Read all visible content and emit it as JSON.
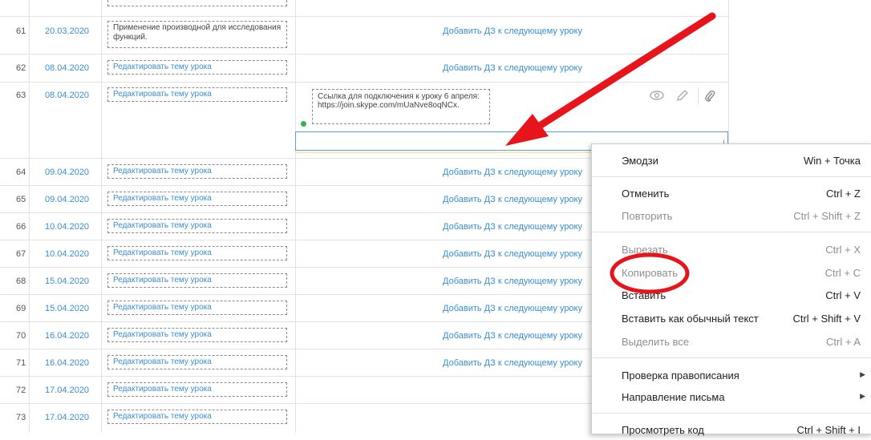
{
  "rows": [
    {
      "num": "61",
      "date": "20.03.2020",
      "topic": "Применение производной для исследования функций.",
      "topic_plain": true,
      "action": "Добавить ДЗ к следующему уроку"
    },
    {
      "num": "62",
      "date": "08.04.2020",
      "topic": "Редактировать тему урока",
      "topic_plain": false,
      "action": "Добавить ДЗ к следующему уроку"
    },
    {
      "num": "63",
      "date": "08.04.2020",
      "topic": "Редактировать тему урока",
      "topic_plain": false,
      "action": ""
    },
    {
      "num": "64",
      "date": "09.04.2020",
      "topic": "Редактировать тему урока",
      "topic_plain": false,
      "action": "Добавить ДЗ к следующему уроку"
    },
    {
      "num": "65",
      "date": "09.04.2020",
      "topic": "Редактировать тему урока",
      "topic_plain": false,
      "action": "Добавить ДЗ к следующему уроку"
    },
    {
      "num": "66",
      "date": "10.04.2020",
      "topic": "Редактировать тему урока",
      "topic_plain": false,
      "action": "Добавить ДЗ к следующему уроку"
    },
    {
      "num": "67",
      "date": "10.04.2020",
      "topic": "Редактировать тему урока",
      "topic_plain": false,
      "action": "Добавить ДЗ к следующему уроку"
    },
    {
      "num": "68",
      "date": "15.04.2020",
      "topic": "Редактировать тему урока",
      "topic_plain": false,
      "action": "Добавить ДЗ к следующему уроку"
    },
    {
      "num": "69",
      "date": "15.04.2020",
      "topic": "Редактировать тему урока",
      "topic_plain": false,
      "action": "Добавить ДЗ к следующему уроку"
    },
    {
      "num": "70",
      "date": "16.04.2020",
      "topic": "Редактировать тему урока",
      "topic_plain": false,
      "action": "Добавить ДЗ к следующему уроку"
    },
    {
      "num": "71",
      "date": "16.04.2020",
      "topic": "Редактировать тему урока",
      "topic_plain": false,
      "action": "Добавить ДЗ к следующему уроку"
    },
    {
      "num": "72",
      "date": "17.04.2020",
      "topic": "Редактировать тему урока",
      "topic_plain": false,
      "action": ""
    },
    {
      "num": "73",
      "date": "17.04.2020",
      "topic": "Редактировать тему урока",
      "topic_plain": false,
      "action": ""
    }
  ],
  "homework_note": "Ссылка для подключения к уроку 6 апреля: https://join.skype.com/mUaNve8oqNCx.",
  "homework_icons": [
    "eye-icon",
    "pencil-icon",
    "paperclip-icon"
  ],
  "context_menu": [
    {
      "label": "Эмодзи",
      "shortcut": "Win + Точка",
      "disabled": false
    },
    {
      "label": "Отменить",
      "shortcut": "Ctrl + Z",
      "disabled": false
    },
    {
      "label": "Повторить",
      "shortcut": "Ctrl + Shift + Z",
      "disabled": true
    },
    {
      "label": "Вырезать",
      "shortcut": "Ctrl + X",
      "disabled": true
    },
    {
      "label": "Копировать",
      "shortcut": "Ctrl + C",
      "disabled": true
    },
    {
      "label": "Вставить",
      "shortcut": "Ctrl + V",
      "disabled": false
    },
    {
      "label": "Вставить как обычный текст",
      "shortcut": "Ctrl + Shift + V",
      "disabled": false
    },
    {
      "label": "Выделить все",
      "shortcut": "Ctrl + A",
      "disabled": true
    },
    {
      "label": "Проверка правописания",
      "shortcut": "",
      "disabled": false,
      "submenu": true
    },
    {
      "label": "Направление письма",
      "shortcut": "",
      "disabled": false,
      "submenu": true
    },
    {
      "label": "Просмотреть код",
      "shortcut": "Ctrl + Shift + I",
      "disabled": false
    }
  ],
  "colors": {
    "link": "#3a8fd0",
    "annotation": "#e8141b",
    "online_dot": "#37b24d"
  }
}
